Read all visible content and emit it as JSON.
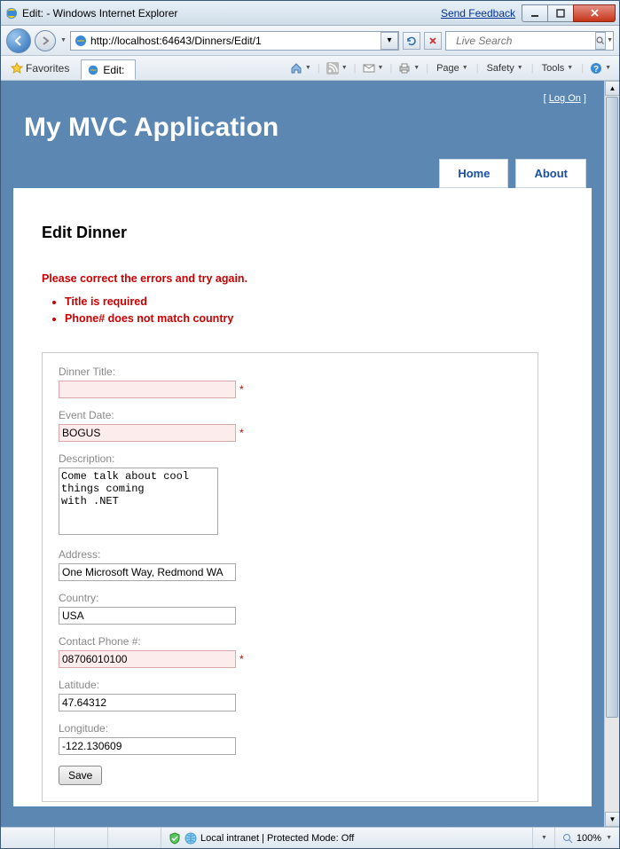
{
  "window": {
    "title": "Edit: - Windows Internet Explorer",
    "send_feedback": "Send Feedback"
  },
  "nav": {
    "url": "http://localhost:64643/Dinners/Edit/1",
    "search_placeholder": "Live Search"
  },
  "favorites": {
    "label": "Favorites"
  },
  "tab": {
    "title": "Edit:"
  },
  "cmd": {
    "page": "Page",
    "safety": "Safety",
    "tools": "Tools"
  },
  "logon": {
    "label": "Log On"
  },
  "app": {
    "title": "My MVC Application"
  },
  "navtabs": {
    "home": "Home",
    "about": "About"
  },
  "content": {
    "heading": "Edit Dinner",
    "error_summary": "Please correct the errors and try again.",
    "errors": [
      "Title is required",
      "Phone# does not match country"
    ]
  },
  "form": {
    "title_label": "Dinner Title:",
    "title_value": "",
    "date_label": "Event Date:",
    "date_value": "BOGUS",
    "desc_label": "Description:",
    "desc_value": "Come talk about cool things coming\nwith .NET",
    "addr_label": "Address:",
    "addr_value": "One Microsoft Way, Redmond WA",
    "country_label": "Country:",
    "country_value": "USA",
    "phone_label": "Contact Phone #:",
    "phone_value": "08706010100",
    "lat_label": "Latitude:",
    "lat_value": "47.64312",
    "lon_label": "Longitude:",
    "lon_value": "-122.130609",
    "save": "Save",
    "asterisk": "*"
  },
  "status": {
    "zone": "Local intranet | Protected Mode: Off",
    "zoom": "100%"
  }
}
